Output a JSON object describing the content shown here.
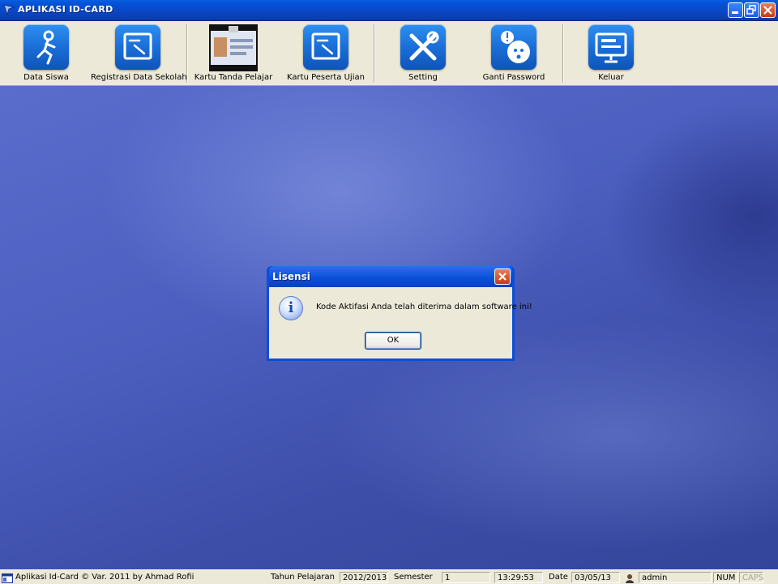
{
  "window": {
    "title": "APLIKASI ID-CARD"
  },
  "toolbar": {
    "items": [
      {
        "label": "Data Siswa"
      },
      {
        "label": "Registrasi Data Sekolah"
      },
      {
        "label": "Kartu Tanda Pelajar"
      },
      {
        "label": "Kartu Peserta Ujian"
      },
      {
        "label": "Setting"
      },
      {
        "label": "Ganti Password"
      },
      {
        "label": "Keluar"
      }
    ]
  },
  "dialog": {
    "title": "Lisensi",
    "message": "Kode Aktifasi Anda telah diterima dalam software ini!",
    "ok_label": "OK"
  },
  "statusbar": {
    "app_info": "Aplikasi Id-Card © Var. 2011 by Ahmad Rofii",
    "year_label": "Tahun Pelajaran",
    "year_value": "2012/2013",
    "semester_label": "Semester",
    "semester_value": "1",
    "time": "13:29:53",
    "date_label": "Date",
    "date_value": "03/05/13",
    "user": "admin",
    "num": "NUM",
    "caps": "CAPS"
  },
  "colors": {
    "accent": "#0a4ed8",
    "toolbar_bg": "#ece9d8",
    "desktop": "#4c5fc0"
  }
}
